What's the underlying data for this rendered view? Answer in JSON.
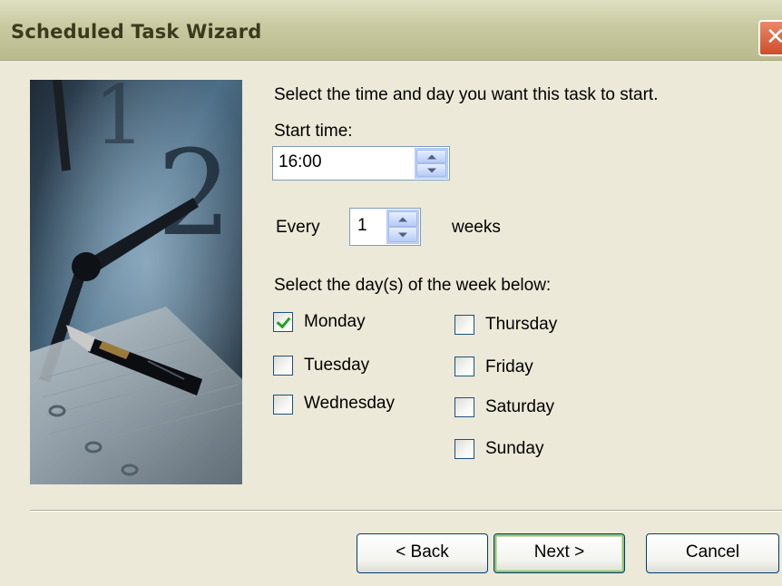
{
  "window": {
    "title": "Scheduled Task Wizard",
    "close_glyph": "✕"
  },
  "instructions": "Select the time and day you want this task to start.",
  "start_time": {
    "label": "Start time:",
    "value": "16:00"
  },
  "recurrence": {
    "every_label": "Every",
    "value": "1",
    "unit_label": "weeks"
  },
  "days": {
    "label": "Select the day(s) of the week below:",
    "items": [
      {
        "label": "Monday",
        "checked": true
      },
      {
        "label": "Tuesday",
        "checked": false
      },
      {
        "label": "Wednesday",
        "checked": false
      },
      {
        "label": "Thursday",
        "checked": false
      },
      {
        "label": "Friday",
        "checked": false
      },
      {
        "label": "Saturday",
        "checked": false
      },
      {
        "label": "Sunday",
        "checked": false
      }
    ]
  },
  "buttons": {
    "back": "< Back",
    "next": "Next >",
    "cancel": "Cancel"
  },
  "icons": {
    "close": "close-icon",
    "spin_up": "chevron-up-icon",
    "spin_down": "chevron-down-icon",
    "checkmark": "checkmark-icon"
  },
  "colors": {
    "titlebar": "#c8c99f",
    "dialog_bg": "#ece9d8",
    "close_button": "#cf4d2b",
    "checkmark": "#21a121",
    "default_button_ring": "#91c272"
  }
}
